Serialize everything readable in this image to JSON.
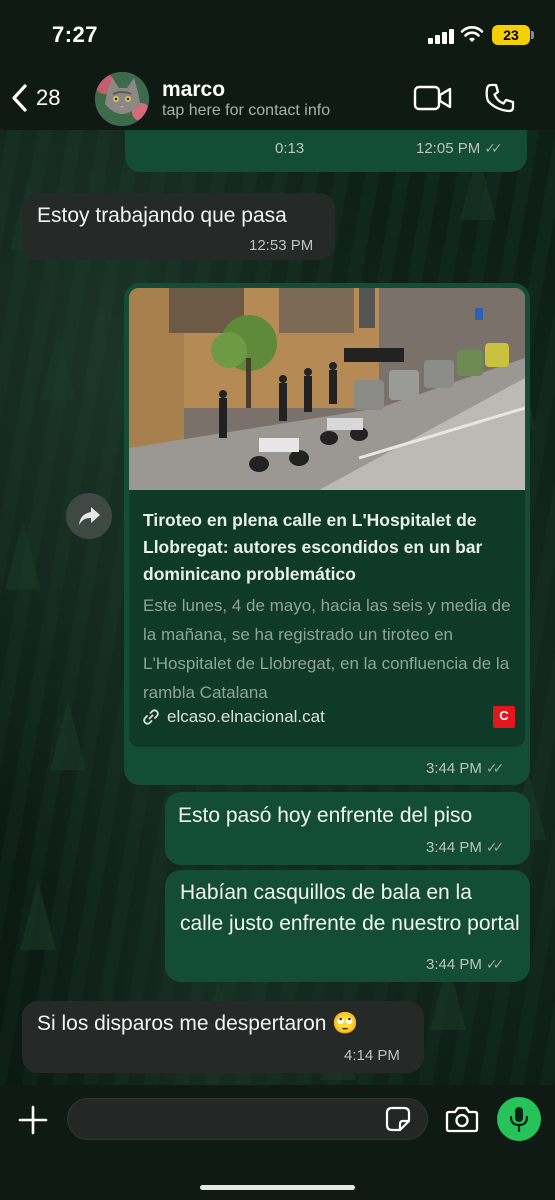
{
  "status_bar": {
    "time": "7:27",
    "battery": "23"
  },
  "header": {
    "back_count": "28",
    "contact_name": "marco",
    "contact_subtitle": "tap here for contact info"
  },
  "messages": [
    {
      "type": "voice",
      "direction": "outgoing",
      "duration": "0:13",
      "time": "12:05 PM",
      "read": true
    },
    {
      "type": "text",
      "direction": "incoming",
      "text": "Estoy trabajando que pasa",
      "time": "12:53 PM"
    },
    {
      "type": "link",
      "direction": "outgoing",
      "title": "Tiroteo en plena calle en L'Hospitalet de Llobregat: autores escondidos en un bar dominicano problemático",
      "description": "Este lunes, 4 de mayo, hacia las seis y media de la mañana, se ha registrado un tiroteo en L'Hospitalet de Llobregat, en la confluencia de la rambla Catalana",
      "domain": "elcaso.elnacional.cat",
      "logo_letter": "C",
      "time": "3:44 PM",
      "read": true
    },
    {
      "type": "text",
      "direction": "outgoing",
      "text": "Esto pasó hoy enfrente del piso",
      "time": "3:44 PM",
      "read": true
    },
    {
      "type": "text",
      "direction": "outgoing",
      "text": "Habían casquillos de bala en la calle justo enfrente de nuestro portal",
      "time": "3:44 PM",
      "read": true
    },
    {
      "type": "text",
      "direction": "incoming",
      "text": "Si los disparos me despertaron 🙄",
      "time": "4:14 PM"
    }
  ],
  "input": {
    "value": "",
    "placeholder": ""
  },
  "colors": {
    "outgoing_bubble": "#144d35",
    "incoming_bubble": "#252a28",
    "mic_button": "#25c35a",
    "battery": "#f4d000",
    "site_logo": "#e3161d"
  },
  "icons": {
    "back": "chevron-left-icon",
    "video": "video-camera-icon",
    "call": "phone-icon",
    "forward": "forward-arrow-icon",
    "link": "link-icon",
    "plus": "plus-icon",
    "sticker": "sticker-icon",
    "camera": "camera-icon",
    "mic": "microphone-icon"
  }
}
